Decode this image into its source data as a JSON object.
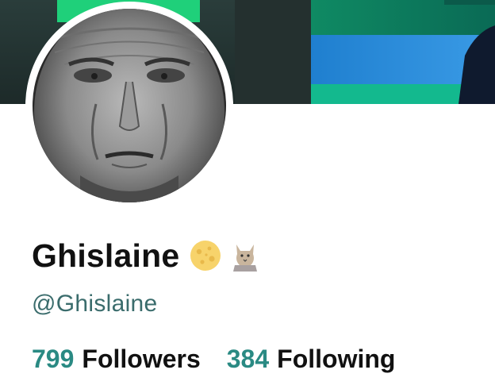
{
  "profile": {
    "display_name": "Ghislaine",
    "handle": "@Ghislaine",
    "name_emojis": [
      "moon-emoji",
      "cat-emoji"
    ]
  },
  "stats": {
    "followers_count": "799",
    "followers_label": "Followers",
    "following_count": "384",
    "following_label": "Following"
  },
  "colors": {
    "accent": "#2a8a83",
    "handle": "#3a6c6c",
    "text": "#111111",
    "banner_dark": "#243b38",
    "banner_green": "#1fa36b",
    "banner_blue": "#2a86d8"
  }
}
